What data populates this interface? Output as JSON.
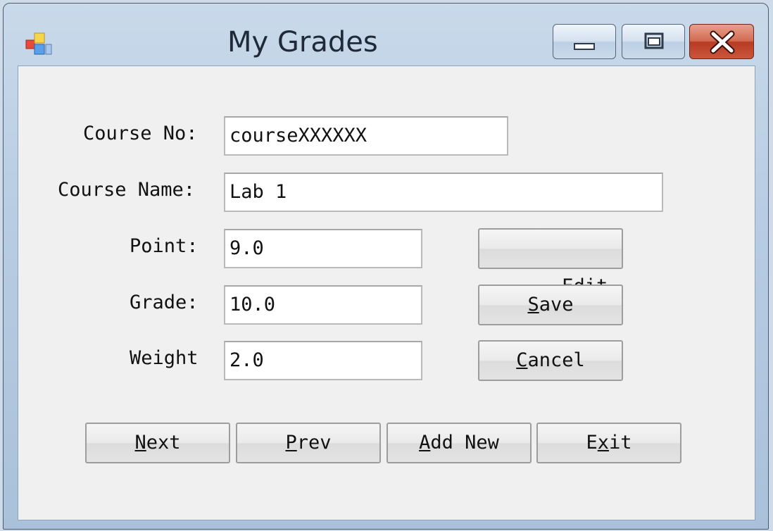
{
  "window": {
    "title": "My Grades",
    "app_icon": "app-icon",
    "caption_buttons": [
      "minimize-icon",
      "restore-icon",
      "close-icon"
    ]
  },
  "form": {
    "course_no": {
      "label": "Course No:",
      "value": "courseXXXXXX"
    },
    "course_name": {
      "label": "Course Name:",
      "value": "Lab 1"
    },
    "point": {
      "label": "Point:",
      "value": "9.0"
    },
    "grade": {
      "label": "Grade:",
      "value": "10.0"
    },
    "weight": {
      "label": "Weight",
      "value": "2.0"
    }
  },
  "side_buttons": {
    "edit": {
      "label": "Edit",
      "mnemonic": ""
    },
    "save": {
      "label": "Save",
      "mnemonic": "S"
    },
    "cancel": {
      "label": "Cancel",
      "mnemonic": "C"
    }
  },
  "nav_buttons": {
    "next": {
      "label": "Next",
      "mnemonic": "N"
    },
    "prev": {
      "label": "Prev",
      "mnemonic": "P"
    },
    "add_new": {
      "label": "Add New",
      "mnemonic": "A"
    },
    "exit": {
      "label": "Exit",
      "mnemonic": "x"
    }
  },
  "colors": {
    "client_bg": "#f0f0f0",
    "close_red": "#c9563c",
    "title_text": "#1f2937"
  }
}
